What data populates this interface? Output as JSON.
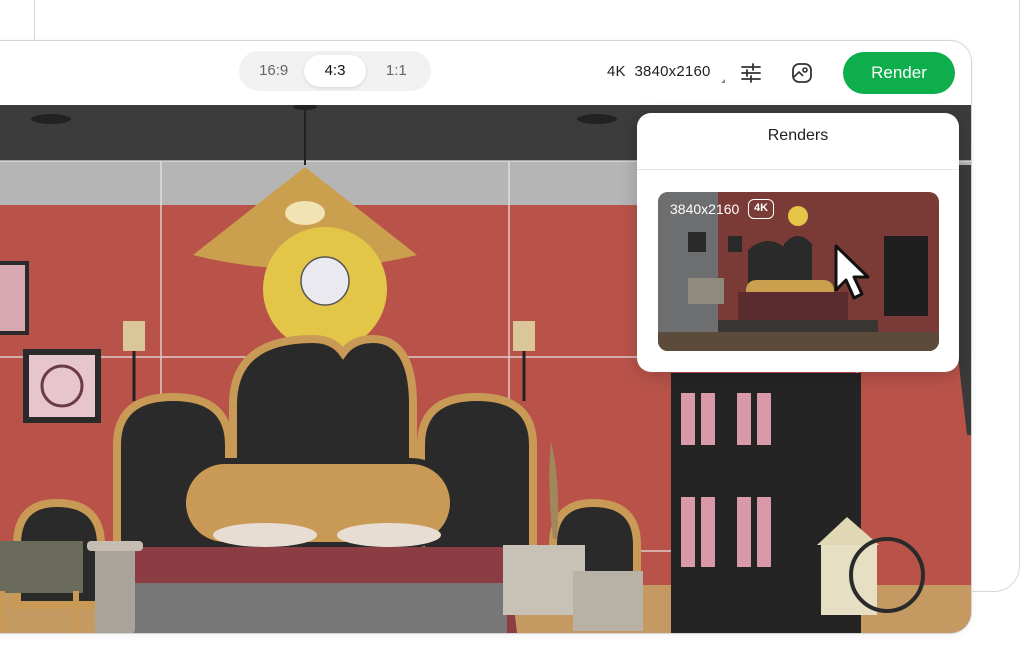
{
  "toolbar": {
    "aspect_ratios": [
      "16:9",
      "4:3",
      "1:1"
    ],
    "selected_ratio": "4:3",
    "resolution_label": "4K",
    "resolution_value": "3840x2160",
    "render_label": "Render",
    "icons": [
      "sliders-icon",
      "image-settings-icon"
    ],
    "accent_color": "#0fae4c"
  },
  "renders_panel": {
    "title": "Renders",
    "items": [
      {
        "resolution": "3840x2160",
        "badge": "4K"
      }
    ]
  },
  "scene": {
    "description_colors": {
      "wall": "#b9534a",
      "ceiling": "#3e3e3e",
      "floor": "#c49a62"
    }
  }
}
